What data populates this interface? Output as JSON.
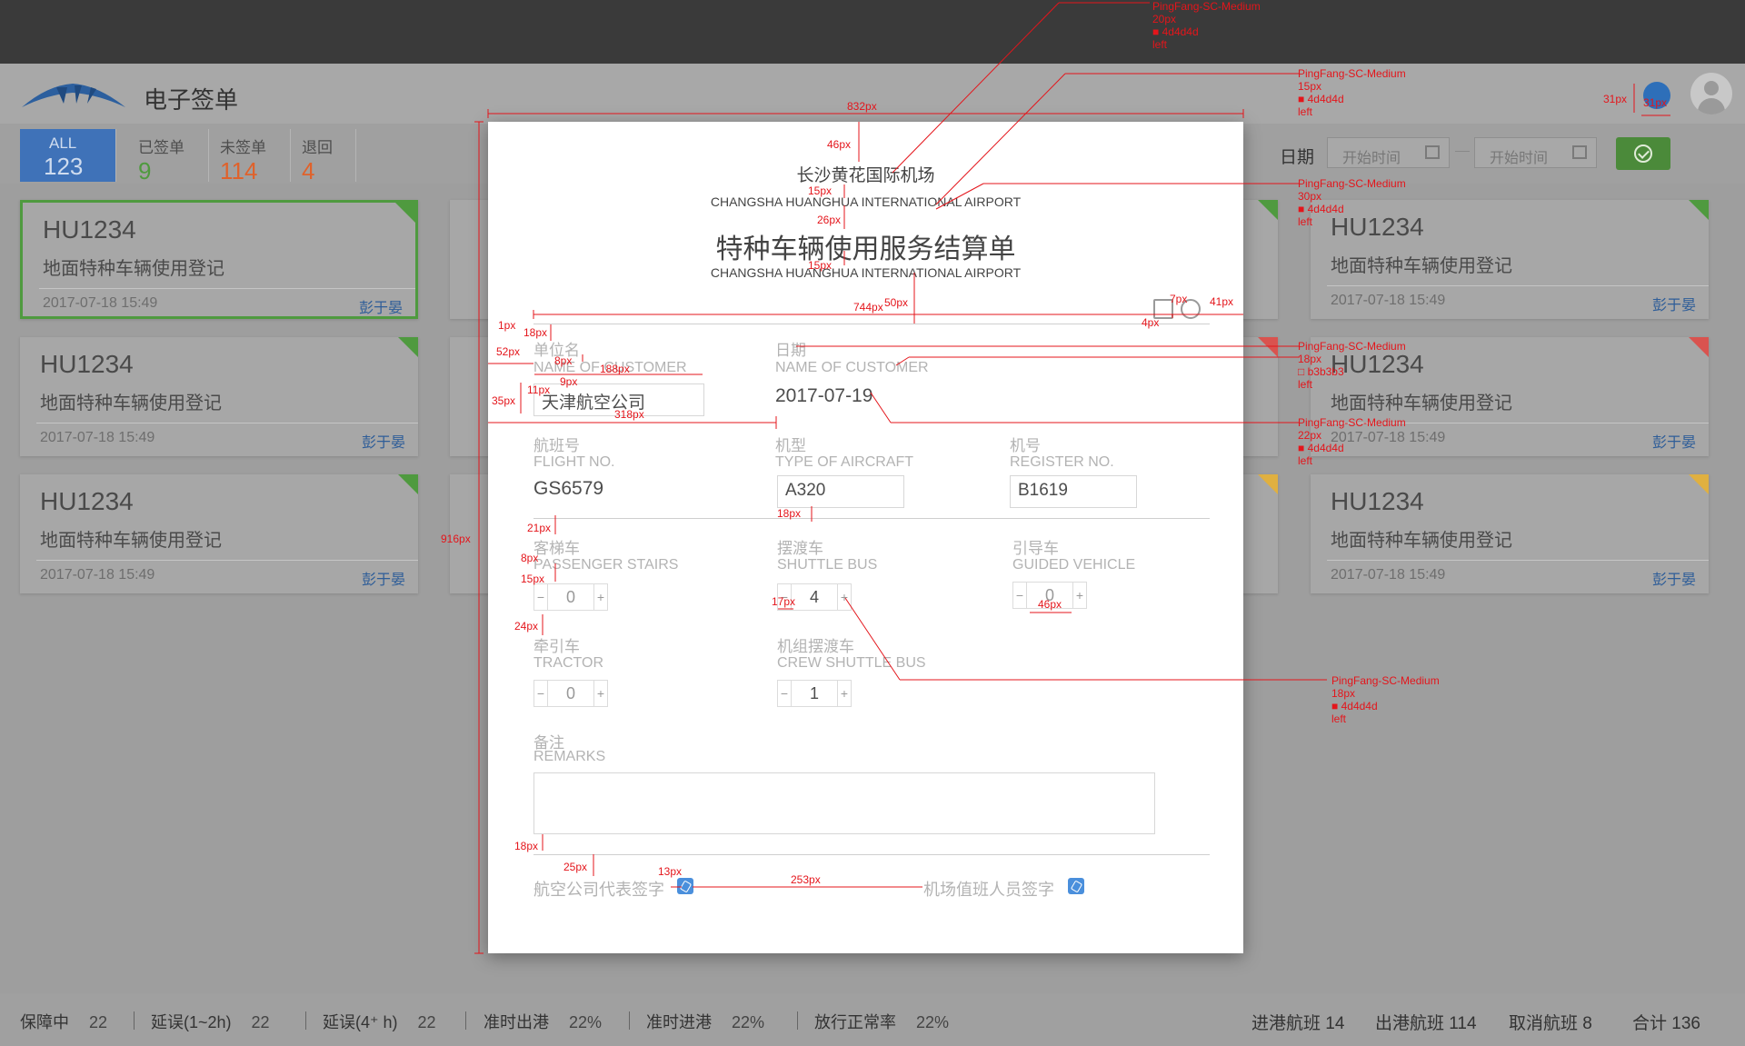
{
  "header": {
    "app_title": "电子签单"
  },
  "tabs": [
    {
      "label": "ALL",
      "count": "123",
      "color": "#cfdcef"
    },
    {
      "label": "已签单",
      "count": "9",
      "color": "#4f9a3f"
    },
    {
      "label": "未签单",
      "count": "114",
      "color": "#e0622b"
    },
    {
      "label": "退回",
      "count": "4",
      "color": "#e0622b"
    }
  ],
  "filter": {
    "date_label": "日期",
    "start_placeholder": "开始时间",
    "end_placeholder": "开始时间"
  },
  "cards": [
    {
      "flight": "HU1234",
      "desc": "地面特种车辆使用登记",
      "time": "2017-07-18 15:49",
      "person": "彭于晏",
      "status_color": "#4f9a3f"
    },
    {
      "flight": "HU1234",
      "desc": "地面特种车辆使用登记",
      "time": "2017-07-18 15:49",
      "person": "彭于晏",
      "status_color": "#4f9a3f"
    },
    {
      "flight": "HU1234",
      "desc": "地面特种车辆使用登记",
      "time": "2017-07-18 15:49",
      "person": "彭于晏",
      "status_color": "#4f9a3f"
    },
    {
      "flight": "HU1234",
      "desc": "地面特种车辆使用登记",
      "time": "2017-07-18 15:49",
      "person": "彭于晏",
      "status_color": "#4f9a3f"
    },
    {
      "flight": "HU1234",
      "desc": "地面特种车辆使用登记",
      "time": "2017-07-18 15:49",
      "person": "彭于晏",
      "status_color": "#d9534f"
    },
    {
      "flight": "HU1234",
      "desc": "地面特种车辆使用登记",
      "time": "2017-07-18 15:49",
      "person": "彭于晏",
      "status_color": "#e0b040"
    }
  ],
  "status_bar": {
    "items": [
      {
        "label": "保障中",
        "value": "22"
      },
      {
        "label": "延误(1~2h)",
        "value": "22"
      },
      {
        "label": "延误(4⁺ h)",
        "value": "22"
      },
      {
        "label": "准时出港",
        "value": "22%"
      },
      {
        "label": "准时进港",
        "value": "22%"
      },
      {
        "label": "放行正常率",
        "value": "22%"
      }
    ],
    "totals": [
      "进港航班 14",
      "出港航班 114",
      "取消航班 8",
      "合计 136"
    ]
  },
  "modal": {
    "airport_cn": "长沙黄花国际机场",
    "airport_en": "CHANGSHA HUANGHUA INTERNATIONAL AIRPORT",
    "title_cn": "特种车辆使用服务结算单",
    "title_en": "CHANGSHA HUANGHUA INTERNATIONAL AIRPORT",
    "customer": {
      "label_cn": "单位名",
      "label_en": "NAME OF CUSTOMER",
      "value": "天津航空公司"
    },
    "date": {
      "label_cn": "日期",
      "label_en": "NAME OF CUSTOMER",
      "value": "2017-07-19"
    },
    "flight_no": {
      "label_cn": "航班号",
      "label_en": "FLIGHT NO.",
      "value": "GS6579"
    },
    "aircraft": {
      "label_cn": "机型",
      "label_en": "TYPE OF AIRCRAFT",
      "value": "A320"
    },
    "register": {
      "label_cn": "机号",
      "label_en": "REGISTER NO.",
      "value": "B1619"
    },
    "stairs": {
      "label_cn": "客梯车",
      "label_en": "PASSENGER STAIRS",
      "value": "0"
    },
    "shuttle": {
      "label_cn": "摆渡车",
      "label_en": "SHUTTLE BUS",
      "value": "4"
    },
    "guided": {
      "label_cn": "引导车",
      "label_en": "GUIDED VEHICLE",
      "value": "0"
    },
    "tractor": {
      "label_cn": "牵引车",
      "label_en": "TRACTOR",
      "value": "0"
    },
    "crew_shuttle": {
      "label_cn": "机组摆渡车",
      "label_en": "CREW SHUTTLE BUS",
      "value": "1"
    },
    "remarks": {
      "label_cn": "备注",
      "label_en": "REMARKS"
    },
    "sign_airline": "航空公司代表签字",
    "sign_airport": "机场值班人员签字",
    "stepper_minus": "−",
    "stepper_plus": "+"
  },
  "annotations": {
    "w832": "832px",
    "h46": "46px",
    "h15a": "15px",
    "h26": "26px",
    "h15b": "15px",
    "w744": "744px",
    "h50": "50px",
    "w7": "7px",
    "w41": "41px",
    "w4": "4px",
    "w1": "1px",
    "h18a": "18px",
    "w52": "52px",
    "h8a": "8px",
    "w188": "188px",
    "h9": "9px",
    "h11": "11px",
    "h35": "35px",
    "w318": "318px",
    "h18b": "18px",
    "h21": "21px",
    "h8b": "8px",
    "h15c": "15px",
    "w17": "17px",
    "w46": "46px",
    "h24": "24px",
    "h18c": "18px",
    "h25": "25px",
    "w13": "13px",
    "w253": "253px",
    "h916": "916px",
    "h31": "31px",
    "w31": "31px",
    "spec1": [
      "PingFang-SC-Medium",
      "20px",
      "4d4d4d",
      "left"
    ],
    "spec2": [
      "PingFang-SC-Medium",
      "15px",
      "4d4d4d",
      "left"
    ],
    "spec3": [
      "PingFang-SC-Medium",
      "30px",
      "4d4d4d",
      "left"
    ],
    "spec4": [
      "PingFang-SC-Medium",
      "18px",
      "b3b3b3",
      "left"
    ],
    "spec5": [
      "PingFang-SC-Medium",
      "22px",
      "4d4d4d",
      "left"
    ],
    "spec6": [
      "PingFang-SC-Medium",
      "18px",
      "4d4d4d",
      "left"
    ]
  }
}
